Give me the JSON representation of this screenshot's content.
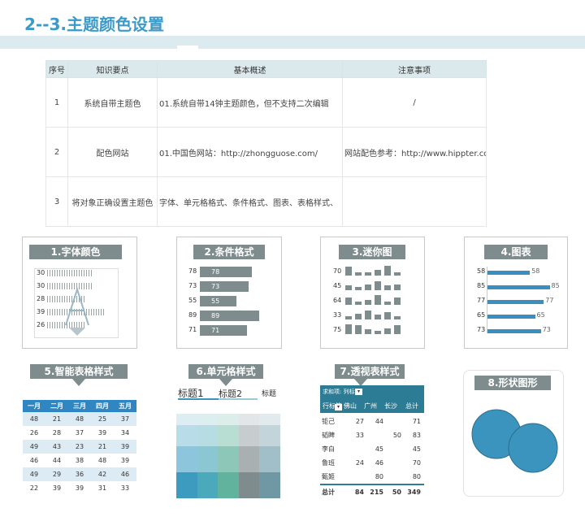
{
  "title": "2--3.主题颜色设置",
  "table": {
    "headers": [
      "序号",
      "知识要点",
      "基本概述",
      "注意事项"
    ],
    "rows": [
      [
        "1",
        "系统自带主题色",
        "01.系统自带14钟主题颜色，但不支持二次编辑",
        "/"
      ],
      [
        "2",
        "配色网站",
        "01.中国色网站：http://zhongguose.com/",
        "网站配色参考：http://www.hippter.cor"
      ],
      [
        "3",
        "将对象正确设置主题色",
        "字体、单元格格式、条件格式、图表、表格样式、",
        ""
      ]
    ]
  },
  "panels": {
    "p1": {
      "label": "1.字体颜色",
      "values": [
        "30",
        "30",
        "28",
        "39",
        "26"
      ]
    },
    "p2": {
      "label": "2.条件格式",
      "values": [
        "78",
        "73",
        "55",
        "89",
        "71"
      ]
    },
    "p3": {
      "label": "3.迷你图",
      "values": [
        "70",
        "45",
        "64",
        "33",
        "75"
      ]
    },
    "p4": {
      "label": "4.图表",
      "values": [
        "58",
        "85",
        "77",
        "65",
        "73"
      ]
    },
    "p5": {
      "label": "5.智能表格样式",
      "headers": [
        "一月",
        "二月",
        "三月",
        "四月",
        "五月"
      ],
      "rows": [
        [
          "48",
          "21",
          "48",
          "25",
          "37"
        ],
        [
          "26",
          "28",
          "37",
          "39",
          "34"
        ],
        [
          "49",
          "43",
          "23",
          "21",
          "39"
        ],
        [
          "46",
          "44",
          "38",
          "48",
          "39"
        ],
        [
          "49",
          "29",
          "36",
          "42",
          "46"
        ],
        [
          "22",
          "39",
          "39",
          "31",
          "33"
        ]
      ]
    },
    "p6": {
      "label": "6.单元格样式",
      "heading1": "标题1",
      "heading2": "标题2",
      "heading3": "标题"
    },
    "p7": {
      "label": "7.透视表样式",
      "filter_label": "求和项: 列标",
      "col_headers": [
        "行标签",
        "佛山",
        "广州",
        "长沙",
        "总计"
      ],
      "rows": [
        [
          "钜己",
          "27",
          "44",
          "",
          "71"
        ],
        [
          "韬睥",
          "33",
          "",
          "50",
          "83"
        ],
        [
          "李白",
          "",
          "45",
          "",
          "45"
        ],
        [
          "鲁班",
          "24",
          "46",
          "",
          "70"
        ],
        [
          "甄姬",
          "",
          "80",
          "",
          "80"
        ]
      ],
      "total": [
        "总计",
        "84",
        "215",
        "50",
        "349"
      ]
    },
    "p8": {
      "label": "8.形状图形"
    }
  },
  "colors": {
    "accent": "#3a9ac9",
    "label_gray": "#7f8c8d",
    "bar_blue": "#3a8fbf",
    "circle": "#3a94bd"
  }
}
